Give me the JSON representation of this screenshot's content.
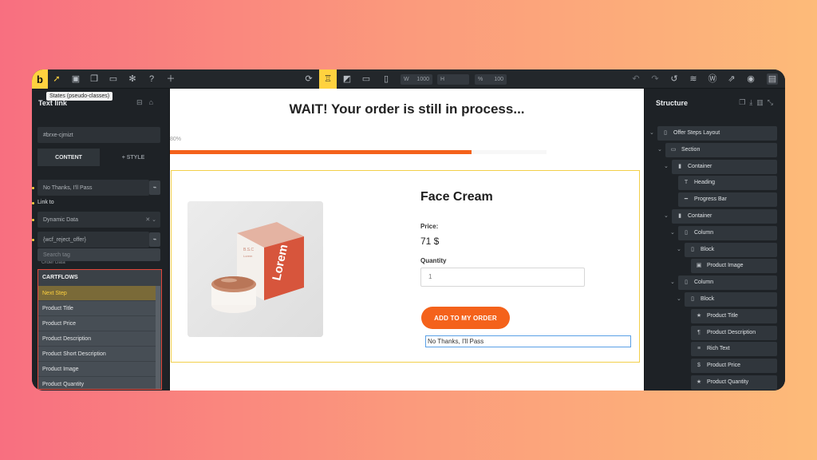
{
  "toolbar": {
    "logo": "b",
    "tooltip": "States (pseudo-classes)",
    "width_label": "W",
    "width_value": "1000",
    "height_label": "H",
    "zoom_label": "%",
    "zoom_value": "100"
  },
  "left_panel": {
    "title": "Text link",
    "css_id": "#brxe-cjmizt",
    "tabs": {
      "content": "CONTENT",
      "style": "+ STYLE"
    },
    "text_value": "No Thanks, I'll Pass",
    "link_to_label": "Link to",
    "link_type": "Dynamic Data",
    "dynamic_tag": "{wcf_reject_offer}",
    "search_placeholder": "Search tag",
    "partial_item": "Order Data",
    "dropdown": {
      "group": "CARTFLOWS",
      "items": [
        "Next Step",
        "Product Title",
        "Product Price",
        "Product Description",
        "Product Short Description",
        "Product Image",
        "Product Quantity"
      ],
      "selected": "Next Step"
    }
  },
  "canvas": {
    "heading": "WAIT! Your order is still in process...",
    "progress_label": "80%",
    "progress": 0.8,
    "product_title": "Face Cream",
    "price_label": "Price:",
    "price_value": "71 $",
    "quantity_label": "Quantity",
    "quantity_value": "1",
    "add_button": "ADD TO MY ORDER",
    "no_thanks": "No Thanks, I'll Pass",
    "box_label_top": "Lorem",
    "box_label_side": "Lorem"
  },
  "right_panel": {
    "title": "Structure",
    "tree": [
      {
        "label": "Offer Steps Layout",
        "icon": "page-icon"
      },
      {
        "label": "Section",
        "icon": "section-icon"
      },
      {
        "label": "Container",
        "icon": "container-icon"
      },
      {
        "label": "Heading",
        "icon": "heading-icon"
      },
      {
        "label": "Progress Bar",
        "icon": "progress-icon"
      },
      {
        "label": "Container",
        "icon": "container-icon"
      },
      {
        "label": "Column",
        "icon": "column-icon"
      },
      {
        "label": "Block",
        "icon": "block-icon"
      },
      {
        "label": "Product Image",
        "icon": "image-icon"
      },
      {
        "label": "Column",
        "icon": "column-icon"
      },
      {
        "label": "Block",
        "icon": "block-icon"
      },
      {
        "label": "Product Title",
        "icon": "star-icon"
      },
      {
        "label": "Product Description",
        "icon": "paragraph-icon"
      },
      {
        "label": "Rich Text",
        "icon": "text-icon"
      },
      {
        "label": "Product Price",
        "icon": "dollar-icon"
      },
      {
        "label": "Product Quantity",
        "icon": "star-icon"
      }
    ]
  },
  "colors": {
    "accent": "#ffd23f",
    "brand_orange": "#f4621b",
    "highlight_red": "#e4473b"
  }
}
